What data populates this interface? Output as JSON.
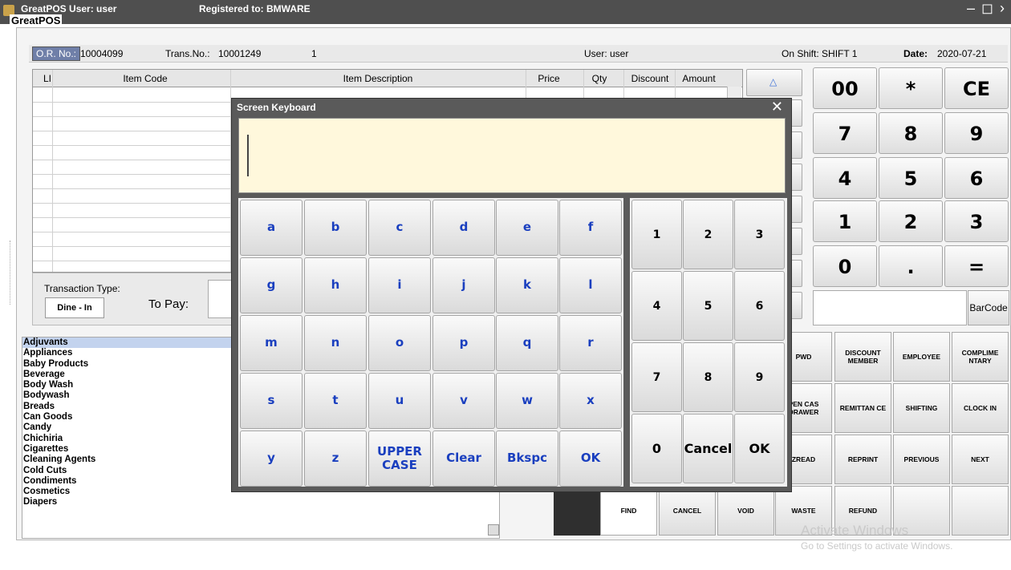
{
  "window": {
    "app": "GreatPOS",
    "user_label": "User: user",
    "registered": "Registered to: BMWARE",
    "app_name": "GreatPOS"
  },
  "info": {
    "or_label": "O.R. No.:",
    "or_value": "10004099",
    "trans_label": "Trans.No.:",
    "trans_value": "10001249",
    "count": "1",
    "user": "User:  user",
    "shift": "On Shift: SHIFT 1",
    "date_label": "Date:",
    "date_value": "2020-07-21"
  },
  "grid": {
    "columns": [
      "LI",
      "Item Code",
      "Item Description",
      "Price",
      "Qty",
      "Discount",
      "Amount"
    ]
  },
  "transaction": {
    "type_label": "Transaction Type:",
    "type_value": "Dine - In",
    "to_pay_label": "To Pay:"
  },
  "categories": [
    "Adjuvants",
    "Appliances",
    "Baby Products",
    "Beverage",
    "Body Wash",
    "Bodywash",
    "Breads",
    "Can Goods",
    "Candy",
    "Chichiria",
    "Cigarettes",
    "Cleaning Agents",
    "Cold Cuts",
    "Condiments",
    "Cosmetics",
    "Diapers"
  ],
  "selected_category": "Adjuvants",
  "numpad": [
    "00",
    "*",
    "CE",
    "7",
    "8",
    "9",
    "4",
    "5",
    "6",
    "1",
    "2",
    "3",
    "0",
    ".",
    "="
  ],
  "barcode_button": "BarCode",
  "function_buttons": {
    "row1": [
      "PWD",
      "DISCOUNT MEMBER",
      "EMPLOYEE",
      "COMPLIME NTARY"
    ],
    "row2": [
      "PEN CAS DRAWER",
      "REMITTAN CE",
      "SHIFTING",
      "CLOCK IN"
    ],
    "row3": [
      "ZREAD",
      "REPRINT",
      "PREVIOUS",
      "NEXT"
    ],
    "row4": [
      "FIND",
      "CANCEL",
      "VOID",
      "WASTE",
      "REFUND"
    ]
  },
  "keyboard": {
    "title": "Screen Keyboard",
    "close": "✕",
    "letters": [
      "a",
      "b",
      "c",
      "d",
      "e",
      "f",
      "g",
      "h",
      "i",
      "j",
      "k",
      "l",
      "m",
      "n",
      "o",
      "p",
      "q",
      "r",
      "s",
      "t",
      "u",
      "v",
      "w",
      "x",
      "y",
      "z",
      "UPPER CASE",
      "Clear",
      "Bkspc",
      "OK"
    ],
    "numbers": [
      "1",
      "2",
      "3",
      "4",
      "5",
      "6",
      "7",
      "8",
      "9",
      "0",
      "Cancel",
      "OK"
    ]
  },
  "watermark": {
    "line1": "Activate Windows",
    "line2": "Go to Settings to activate Windows."
  }
}
